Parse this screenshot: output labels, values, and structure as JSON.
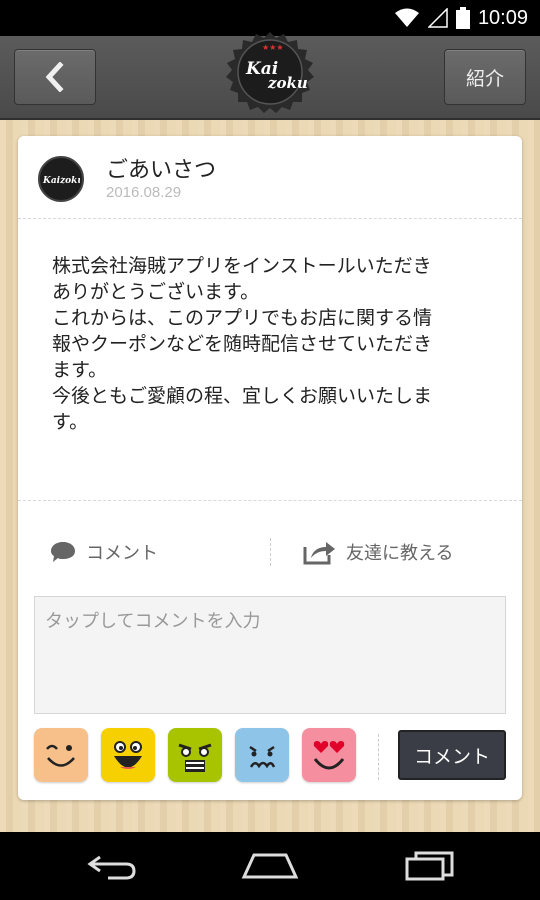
{
  "status_bar": {
    "time": "10:09",
    "icons": [
      "wifi-icon",
      "signal-icon",
      "battery-icon"
    ]
  },
  "header": {
    "back_icon": "chevron-left-icon",
    "logo_text_top": "Kai",
    "logo_text_bottom": "zoku",
    "intro_label": "紹介"
  },
  "post": {
    "avatar_text": "Kaizoku",
    "title": "ごあいさつ",
    "date": "2016.08.29",
    "body_lines": [
      "株式会社海賊アプリをインストールいただき",
      "ありがとうございます。",
      "これからは、このアプリでもお店に関する情",
      "報やクーポンなどを随時配信させていただき",
      "ます。",
      "今後ともご愛顧の程、宜しくお願いいたしま",
      "す。"
    ]
  },
  "actions": {
    "comment_label": "コメント",
    "share_label": "友達に教える"
  },
  "comment_form": {
    "value": "",
    "placeholder": "タップしてコメントを入力",
    "submit_label": "コメント"
  },
  "stamps": [
    {
      "name": "wink-face-stamp",
      "color": "#f7c08a"
    },
    {
      "name": "laughing-face-stamp",
      "color": "#f6d000"
    },
    {
      "name": "angry-face-stamp",
      "color": "#a8c400"
    },
    {
      "name": "sad-face-stamp",
      "color": "#8ec4e8"
    },
    {
      "name": "heart-eyes-face-stamp",
      "color": "#f58fa0"
    }
  ],
  "nav": [
    "back-nav-icon",
    "home-nav-icon",
    "recents-nav-icon"
  ]
}
